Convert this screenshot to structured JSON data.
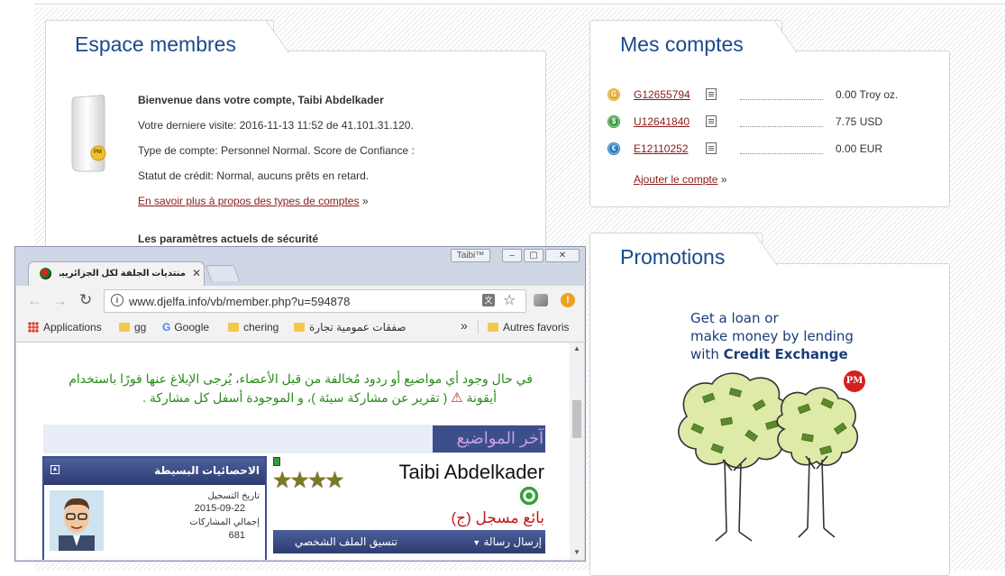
{
  "membres": {
    "title": "Espace membres",
    "welcome": "Bienvenue dans votre compte, Taibi Abdelkader",
    "last_visit": "Votre derniere visite: 2016-11-13 11:52 de 41.101.31.120.",
    "account_type": "Type de compte: Personnel Normal. Score de Confiance :",
    "credit_status": "Statut de crédit: Normal, aucuns prêts en retard.",
    "learn_more": "En savoir plus à propos des types de comptes",
    "learn_more_suffix": "»",
    "security_heading": "Les paramètres actuels de sécurité",
    "logo_text": "PM"
  },
  "comptes": {
    "title": "Mes comptes",
    "accounts": [
      {
        "id": "G12655794",
        "balance": "0.00 Troy oz.",
        "icon": "gold-coin-icon",
        "color": "#e0a526",
        "symbol": "G"
      },
      {
        "id": "U12641840",
        "balance": "7.75 USD",
        "icon": "dollar-coin-icon",
        "color": "#3a9a3a",
        "symbol": "$"
      },
      {
        "id": "E12110252",
        "balance": "0.00 EUR",
        "icon": "euro-coin-icon",
        "color": "#2a7abf",
        "symbol": "€"
      }
    ],
    "add_account": "Ajouter le compte",
    "add_suffix": "»"
  },
  "promotions": {
    "title": "Promotions",
    "line1": "Get a loan or",
    "line2": "make money by lending",
    "line3_prefix": "with ",
    "line3_bold": "Credit Exchange",
    "badge": "PM"
  },
  "browser": {
    "badge": "Taibi™",
    "tab_title": "منتديات الجلفة لكل الجزائريين و",
    "url": "www.djelfa.info/vb/member.php?u=594878",
    "bookmarks": {
      "apps": "Applications",
      "gg": "gg",
      "google": "Google",
      "chering": "chering",
      "arabic": "صفقات عمومية تجارة",
      "more": "»",
      "other": "Autres favoris"
    },
    "page": {
      "notice_line1": "في حال وجود أي مواضيع أو ردود مُخالفة من قبل الأعضاء، يُرجى الإبلاغ عنها فورًا باستخدام",
      "notice_line2": "أيقونة",
      "notice_line2b": "( تقرير عن مشاركة سيئة )، و الموجودة أسفل كل مشاركة .",
      "latest_topics": "آخر المواضيع",
      "stats_title": "الاحصائيات البسيطة",
      "reg_date_label": "تاريخ التسجيل",
      "reg_date": "2015-09-22",
      "posts_label": "إجمالي المشاركات",
      "posts": "681",
      "username": "Taibi Abdelkader",
      "rank": "بائع مسجل (ج)",
      "send_message": "إرسال رسالة",
      "profile_format": "تنسيق الملف الشخصي"
    }
  },
  "colors": {
    "title_blue": "#1a4a8a",
    "link_red": "#8b1a1a",
    "notice_green": "#2a8a1a",
    "forum_bar": "#3d4f8a"
  }
}
